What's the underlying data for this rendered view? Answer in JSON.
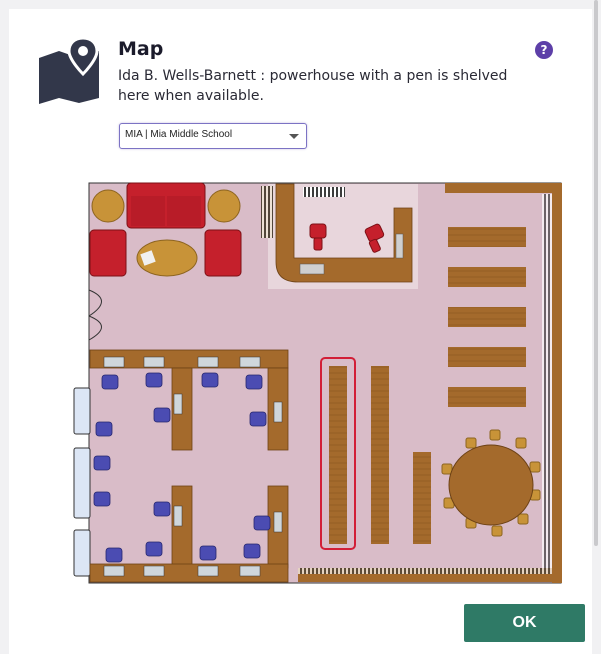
{
  "dialog": {
    "title": "Map",
    "subtitle": "Ida B. Wells-Barnett : powerhouse with a pen is shelved here when available.",
    "help_icon": "question-circle-icon",
    "help_glyph": "?"
  },
  "location_select": {
    "value": "MIA | Mia Middle School"
  },
  "footer": {
    "ok_label": "OK"
  },
  "colors": {
    "accent": "#5d3fa8",
    "ok_button": "#2f7a66",
    "floor": "#d9bcc8",
    "wood": "#a46a2c",
    "chairs_red": "#c5202c",
    "chairs_blue": "#4b4cb2",
    "highlight": "#d21e37"
  },
  "icons": {
    "map": "map-pin-icon"
  }
}
